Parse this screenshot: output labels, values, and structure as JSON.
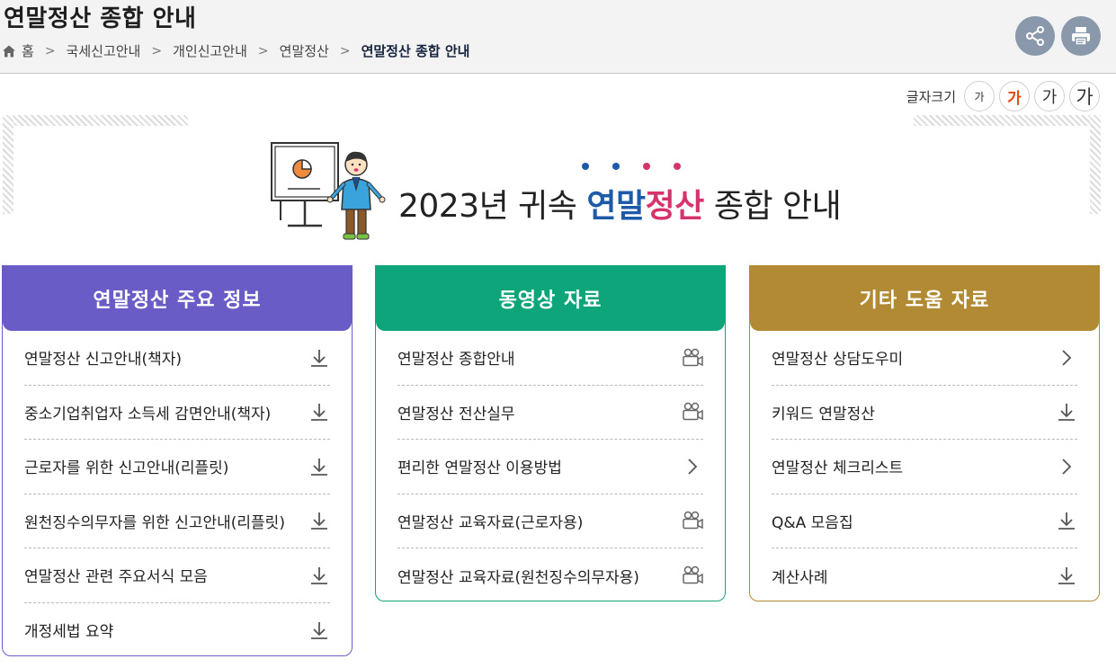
{
  "header": {
    "title": "연말정산 종합 안내",
    "breadcrumb": [
      "홈",
      "국세신고안내",
      "개인신고안내",
      "연말정산",
      "연말정산 종합 안내"
    ]
  },
  "actions": {
    "share_icon": "share-icon",
    "print_icon": "print-icon"
  },
  "font_size": {
    "label": "글자크기",
    "options": [
      "가",
      "가",
      "가",
      "가"
    ]
  },
  "banner": {
    "year_text": "2023년 귀속 ",
    "highlight_blue": "연말",
    "highlight_pink": "정산",
    "suffix": " 종합 안내",
    "dot_colors": [
      "#1d5aa8",
      "#1d5aa8",
      "#d6336c",
      "#d6336c"
    ]
  },
  "cards": [
    {
      "title": "연말정산 주요 정보",
      "color": "#6a5cc6",
      "items": [
        {
          "label": "연말정산 신고안내(책자)",
          "icon": "download-icon"
        },
        {
          "label": "중소기업취업자 소득세 감면안내(책자)",
          "icon": "download-icon"
        },
        {
          "label": "근로자를 위한 신고안내(리플릿)",
          "icon": "download-icon"
        },
        {
          "label": "원천징수의무자를 위한 신고안내(리플릿)",
          "icon": "download-icon"
        },
        {
          "label": "연말정산 관련 주요서식 모음",
          "icon": "download-icon"
        },
        {
          "label": "개정세법 요약",
          "icon": "download-icon"
        }
      ]
    },
    {
      "title": "동영상 자료",
      "color": "#0fa57a",
      "items": [
        {
          "label": "연말정산 종합안내",
          "icon": "video-camera-icon"
        },
        {
          "label": "연말정산 전산실무",
          "icon": "video-camera-icon"
        },
        {
          "label": "편리한 연말정산 이용방법",
          "icon": "chevron-right-icon"
        },
        {
          "label": "연말정산 교육자료(근로자용)",
          "icon": "video-camera-icon"
        },
        {
          "label": "연말정산 교육자료(원천징수의무자용)",
          "icon": "video-camera-icon"
        }
      ]
    },
    {
      "title": "기타 도움 자료",
      "color": "#b38a34",
      "items": [
        {
          "label": "연말정산 상담도우미",
          "icon": "chevron-right-icon"
        },
        {
          "label": "키워드 연말정산",
          "icon": "download-icon"
        },
        {
          "label": "연말정산 체크리스트",
          "icon": "chevron-right-icon"
        },
        {
          "label": "Q&A 모음집",
          "icon": "download-icon"
        },
        {
          "label": "계산사례",
          "icon": "download-icon"
        }
      ]
    }
  ]
}
